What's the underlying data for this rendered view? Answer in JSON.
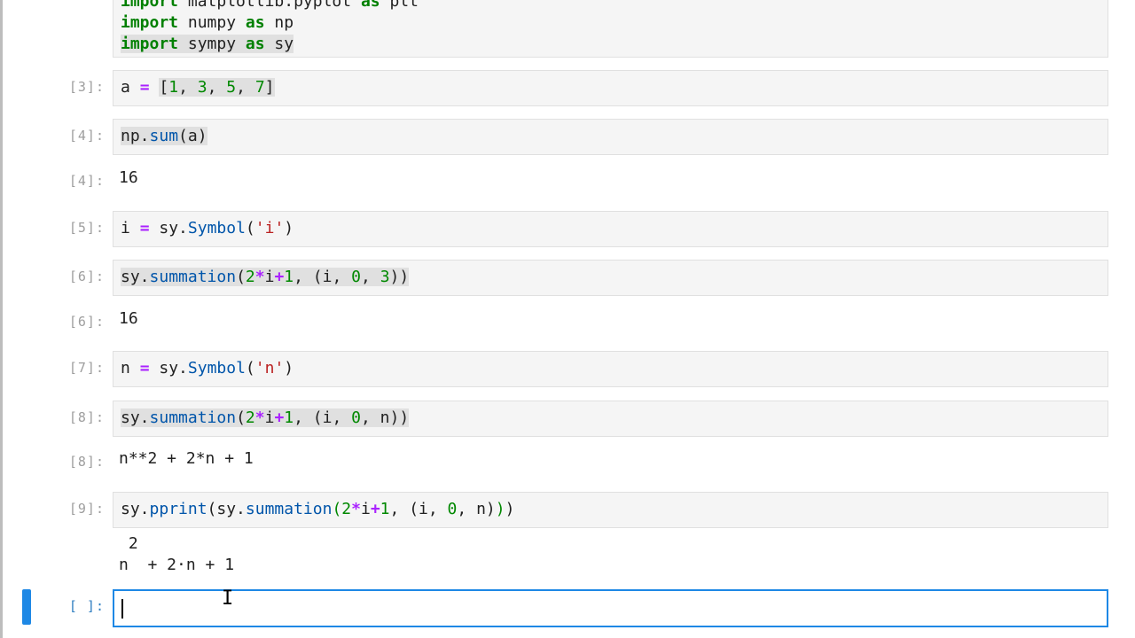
{
  "cells": [
    {
      "prompt": "",
      "lines": [
        [
          {
            "t": "import",
            "c": "kw"
          },
          {
            "t": " matplotlib.pyplot ",
            "c": ""
          },
          {
            "t": "as",
            "c": "kw"
          },
          {
            "t": " plt",
            "c": ""
          }
        ],
        [
          {
            "t": "import",
            "c": "kw"
          },
          {
            "t": " numpy ",
            "c": ""
          },
          {
            "t": "as",
            "c": "kw"
          },
          {
            "t": " np",
            "c": ""
          }
        ],
        [
          {
            "t": "import",
            "c": "kw hl"
          },
          {
            "t": " sympy ",
            "c": "hl"
          },
          {
            "t": "as",
            "c": "kw hl"
          },
          {
            "t": " sy",
            "c": "hl"
          }
        ]
      ]
    },
    {
      "prompt": "[3]:",
      "lines": [
        [
          {
            "t": "a ",
            "c": ""
          },
          {
            "t": "=",
            "c": "op"
          },
          {
            "t": " ",
            "c": ""
          },
          {
            "t": "[",
            "c": "hl"
          },
          {
            "t": "1",
            "c": "num hl"
          },
          {
            "t": ", ",
            "c": "hl"
          },
          {
            "t": "3",
            "c": "num hl"
          },
          {
            "t": ", ",
            "c": "hl"
          },
          {
            "t": "5",
            "c": "num hl"
          },
          {
            "t": ", ",
            "c": "hl"
          },
          {
            "t": "7",
            "c": "num hl"
          },
          {
            "t": "]",
            "c": "hl"
          }
        ]
      ]
    },
    {
      "prompt": "[4]:",
      "lines": [
        [
          {
            "t": "np.",
            "c": "hl"
          },
          {
            "t": "sum",
            "c": "fn hl"
          },
          {
            "t": "(a)",
            "c": "hl"
          }
        ]
      ],
      "out_prompt": "[4]:",
      "output": [
        "16"
      ]
    },
    {
      "prompt": "[5]:",
      "lines": [
        [
          {
            "t": "i ",
            "c": ""
          },
          {
            "t": "=",
            "c": "op"
          },
          {
            "t": " sy.",
            "c": ""
          },
          {
            "t": "Symbol",
            "c": "fn"
          },
          {
            "t": "(",
            "c": ""
          },
          {
            "t": "'i'",
            "c": "str"
          },
          {
            "t": ")",
            "c": ""
          }
        ]
      ]
    },
    {
      "prompt": "[6]:",
      "lines": [
        [
          {
            "t": "sy.",
            "c": "hl"
          },
          {
            "t": "summation",
            "c": "fn hl"
          },
          {
            "t": "(",
            "c": "hl"
          },
          {
            "t": "2",
            "c": "num hl"
          },
          {
            "t": "*",
            "c": "op hl"
          },
          {
            "t": "i",
            "c": "hl"
          },
          {
            "t": "+",
            "c": "op hl"
          },
          {
            "t": "1",
            "c": "num hl"
          },
          {
            "t": ", (i, ",
            "c": "hl"
          },
          {
            "t": "0",
            "c": "num hl"
          },
          {
            "t": ", ",
            "c": "hl"
          },
          {
            "t": "3",
            "c": "num hl"
          },
          {
            "t": "))",
            "c": "hl"
          }
        ]
      ],
      "out_prompt": "[6]:",
      "output": [
        "16"
      ]
    },
    {
      "prompt": "[7]:",
      "lines": [
        [
          {
            "t": "n ",
            "c": ""
          },
          {
            "t": "=",
            "c": "op"
          },
          {
            "t": " sy.",
            "c": ""
          },
          {
            "t": "Symbol",
            "c": "fn"
          },
          {
            "t": "(",
            "c": ""
          },
          {
            "t": "'n'",
            "c": "str"
          },
          {
            "t": ")",
            "c": ""
          }
        ]
      ]
    },
    {
      "prompt": "[8]:",
      "lines": [
        [
          {
            "t": "sy.",
            "c": "hl"
          },
          {
            "t": "summation",
            "c": "fn hl"
          },
          {
            "t": "(",
            "c": "hl"
          },
          {
            "t": "2",
            "c": "num hl"
          },
          {
            "t": "*",
            "c": "op hl"
          },
          {
            "t": "i",
            "c": "hl"
          },
          {
            "t": "+",
            "c": "op hl"
          },
          {
            "t": "1",
            "c": "num hl"
          },
          {
            "t": ", (i, ",
            "c": "hl"
          },
          {
            "t": "0",
            "c": "num hl"
          },
          {
            "t": ", n))",
            "c": "hl"
          }
        ]
      ],
      "out_prompt": "[8]:",
      "output": [
        "n**2 + 2*n + 1"
      ]
    },
    {
      "prompt": "[9]:",
      "lines": [
        [
          {
            "t": "sy.",
            "c": ""
          },
          {
            "t": "pprint",
            "c": "fn"
          },
          {
            "t": "(sy.",
            "c": ""
          },
          {
            "t": "summation",
            "c": "fn"
          },
          {
            "t": "(",
            "c": "num"
          },
          {
            "t": "2",
            "c": "num"
          },
          {
            "t": "*",
            "c": "op"
          },
          {
            "t": "i",
            "c": ""
          },
          {
            "t": "+",
            "c": "op"
          },
          {
            "t": "1",
            "c": "num"
          },
          {
            "t": ", (i, ",
            "c": ""
          },
          {
            "t": "0",
            "c": "num"
          },
          {
            "t": ", n)",
            "c": ""
          },
          {
            "t": ")",
            "c": "num"
          },
          {
            "t": ")",
            "c": ""
          }
        ]
      ],
      "out_prompt": "",
      "output": [
        " 2",
        "n  + 2·n + 1"
      ]
    },
    {
      "prompt": "[ ]:",
      "lines": [],
      "active": true
    }
  ]
}
